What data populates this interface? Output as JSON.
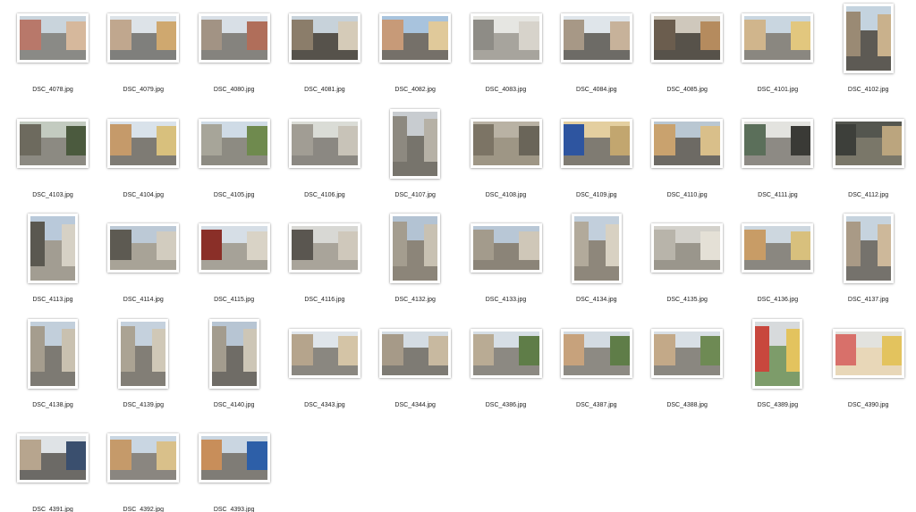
{
  "files": [
    {
      "name": "DSC_4078.jpg",
      "orientation": "landscape",
      "palette": [
        "#c9d4dc",
        "#b8786a",
        "#8a8a86",
        "#d6b89c"
      ]
    },
    {
      "name": "DSC_4079.jpg",
      "orientation": "landscape",
      "palette": [
        "#dde3e8",
        "#c0a78e",
        "#7f7f7c",
        "#cfa86f"
      ]
    },
    {
      "name": "DSC_4080.jpg",
      "orientation": "landscape",
      "palette": [
        "#d8dfe6",
        "#a29384",
        "#85837e",
        "#b06e5a"
      ]
    },
    {
      "name": "DSC_4081.jpg",
      "orientation": "landscape",
      "palette": [
        "#c7d2da",
        "#8b7d6a",
        "#56524b",
        "#d5cbb8"
      ]
    },
    {
      "name": "DSC_4082.jpg",
      "orientation": "landscape",
      "palette": [
        "#a8c3dd",
        "#c79a78",
        "#757069",
        "#e0c99a"
      ]
    },
    {
      "name": "DSC_4083.jpg",
      "orientation": "landscape",
      "palette": [
        "#e6e6e2",
        "#8e8c86",
        "#a7a49d",
        "#d7d3cb"
      ]
    },
    {
      "name": "DSC_4084.jpg",
      "orientation": "landscape",
      "palette": [
        "#dfe5ea",
        "#a79886",
        "#6d6b66",
        "#c7b29a"
      ]
    },
    {
      "name": "DSC_4085.jpg",
      "orientation": "landscape",
      "palette": [
        "#cfc8bc",
        "#6b5d4e",
        "#57524a",
        "#b58b5e"
      ]
    },
    {
      "name": "DSC_4101.jpg",
      "orientation": "landscape",
      "palette": [
        "#c9d6e0",
        "#d0b58c",
        "#8a8780",
        "#e2c77e"
      ]
    },
    {
      "name": "DSC_4102.jpg",
      "orientation": "portrait",
      "palette": [
        "#c4d3df",
        "#9a8a74",
        "#5d5a54",
        "#c9b18c"
      ]
    },
    {
      "name": "DSC_4103.jpg",
      "orientation": "landscape",
      "palette": [
        "#c3cbc0",
        "#6d6a5e",
        "#8c8a82",
        "#4b5a3e"
      ]
    },
    {
      "name": "DSC_4104.jpg",
      "orientation": "landscape",
      "palette": [
        "#d9e2ea",
        "#c59a6a",
        "#7e7b74",
        "#d8c07d"
      ]
    },
    {
      "name": "DSC_4105.jpg",
      "orientation": "landscape",
      "palette": [
        "#cfdbe6",
        "#a7a599",
        "#8d8b82",
        "#6f8a4e"
      ]
    },
    {
      "name": "DSC_4106.jpg",
      "orientation": "landscape",
      "palette": [
        "#dadcd6",
        "#a19d94",
        "#8b8882",
        "#c8c3b8"
      ]
    },
    {
      "name": "DSC_4107.jpg",
      "orientation": "portrait",
      "palette": [
        "#c8ccd0",
        "#8d8980",
        "#77746c",
        "#b6b1a6"
      ]
    },
    {
      "name": "DSC_4108.jpg",
      "orientation": "landscape",
      "palette": [
        "#b9b2a4",
        "#7c7465",
        "#9e9685",
        "#6a6559"
      ]
    },
    {
      "name": "DSC_4109.jpg",
      "orientation": "landscape",
      "palette": [
        "#e4cfa0",
        "#2e55a0",
        "#7f7b72",
        "#c2a66f"
      ]
    },
    {
      "name": "DSC_4110.jpg",
      "orientation": "landscape",
      "palette": [
        "#b9c7d2",
        "#c9a26e",
        "#6d6a64",
        "#d9bf8a"
      ]
    },
    {
      "name": "DSC_4111.jpg",
      "orientation": "landscape",
      "palette": [
        "#e3e3df",
        "#5b6f5a",
        "#8d8a84",
        "#3a3a36"
      ]
    },
    {
      "name": "DSC_4112.jpg",
      "orientation": "landscape",
      "palette": [
        "#54564f",
        "#3d3f3a",
        "#7a7769",
        "#bba57e"
      ]
    },
    {
      "name": "DSC_4113.jpg",
      "orientation": "portrait",
      "palette": [
        "#b9c9da",
        "#5a5850",
        "#a29d92",
        "#d6d1c5"
      ]
    },
    {
      "name": "DSC_4114.jpg",
      "orientation": "landscape",
      "palette": [
        "#bcc9d6",
        "#5d5a52",
        "#a8a397",
        "#d2ccbf"
      ]
    },
    {
      "name": "DSC_4115.jpg",
      "orientation": "landscape",
      "palette": [
        "#d6dee6",
        "#8a2f28",
        "#a6a298",
        "#d9d3c6"
      ]
    },
    {
      "name": "DSC_4116.jpg",
      "orientation": "landscape",
      "palette": [
        "#d8d8d4",
        "#5a5650",
        "#a9a49a",
        "#cfc8bb"
      ]
    },
    {
      "name": "DSC_4132.jpg",
      "orientation": "portrait",
      "palette": [
        "#b3c3d3",
        "#a49d8f",
        "#8c8579",
        "#c8c1b2"
      ]
    },
    {
      "name": "DSC_4133.jpg",
      "orientation": "landscape",
      "palette": [
        "#b8c7d6",
        "#a39b8c",
        "#8b8478",
        "#cfc7b8"
      ]
    },
    {
      "name": "DSC_4134.jpg",
      "orientation": "portrait",
      "palette": [
        "#c2cfdc",
        "#b2aa9b",
        "#8e877b",
        "#d8d1c2"
      ]
    },
    {
      "name": "DSC_4135.jpg",
      "orientation": "landscape",
      "palette": [
        "#d3d1cb",
        "#b8b4aa",
        "#9a968c",
        "#e4e0d6"
      ]
    },
    {
      "name": "DSC_4136.jpg",
      "orientation": "landscape",
      "palette": [
        "#cdd7df",
        "#c89c66",
        "#8a8780",
        "#d8c07d"
      ]
    },
    {
      "name": "DSC_4137.jpg",
      "orientation": "portrait",
      "palette": [
        "#c6d3de",
        "#a99a86",
        "#75726c",
        "#cdb89a"
      ]
    },
    {
      "name": "DSC_4138.jpg",
      "orientation": "portrait",
      "palette": [
        "#c2cfdb",
        "#a59d8e",
        "#7d7a73",
        "#c9c1b0"
      ]
    },
    {
      "name": "DSC_4139.jpg",
      "orientation": "portrait",
      "palette": [
        "#c5d1dd",
        "#aba393",
        "#827e76",
        "#d0c8b7"
      ]
    },
    {
      "name": "DSC_4140.jpg",
      "orientation": "portrait",
      "palette": [
        "#b7c5d3",
        "#a39c8e",
        "#6f6c66",
        "#cdc6b6"
      ]
    },
    {
      "name": "DSC_4343.jpg",
      "orientation": "landscape",
      "palette": [
        "#dfe5ea",
        "#b5a48c",
        "#8a8780",
        "#d4c4a6"
      ]
    },
    {
      "name": "DSC_4344.jpg",
      "orientation": "landscape",
      "palette": [
        "#d4dce3",
        "#a69a88",
        "#7e7b74",
        "#c8b9a0"
      ]
    },
    {
      "name": "DSC_4386.jpg",
      "orientation": "landscape",
      "palette": [
        "#d6dee5",
        "#b9ab94",
        "#8c8982",
        "#5f7d48"
      ]
    },
    {
      "name": "DSC_4387.jpg",
      "orientation": "landscape",
      "palette": [
        "#d3dbe2",
        "#c7a27c",
        "#8d8a83",
        "#5f7d48"
      ]
    },
    {
      "name": "DSC_4388.jpg",
      "orientation": "landscape",
      "palette": [
        "#d8dfe5",
        "#c3a988",
        "#8a8780",
        "#6e8a54"
      ]
    },
    {
      "name": "DSC_4389.jpg",
      "orientation": "portrait",
      "palette": [
        "#d7dadc",
        "#c8473d",
        "#7d9c6a",
        "#e3c35e"
      ]
    },
    {
      "name": "DSC_4390.jpg",
      "orientation": "landscape",
      "palette": [
        "#e2e2de",
        "#d8706a",
        "#e8d7b8",
        "#e3c35e"
      ]
    },
    {
      "name": "DSC_4391.jpg",
      "orientation": "landscape",
      "palette": [
        "#dfe3e6",
        "#b7a58e",
        "#6c6a66",
        "#3a4f6e"
      ]
    },
    {
      "name": "DSC_4392.jpg",
      "orientation": "landscape",
      "palette": [
        "#c9d6e2",
        "#c59a6a",
        "#8a8680",
        "#d9c08a"
      ]
    },
    {
      "name": "DSC_4393.jpg",
      "orientation": "landscape",
      "palette": [
        "#cad6e1",
        "#c88e5a",
        "#7f7c76",
        "#2d5fa8"
      ]
    }
  ]
}
